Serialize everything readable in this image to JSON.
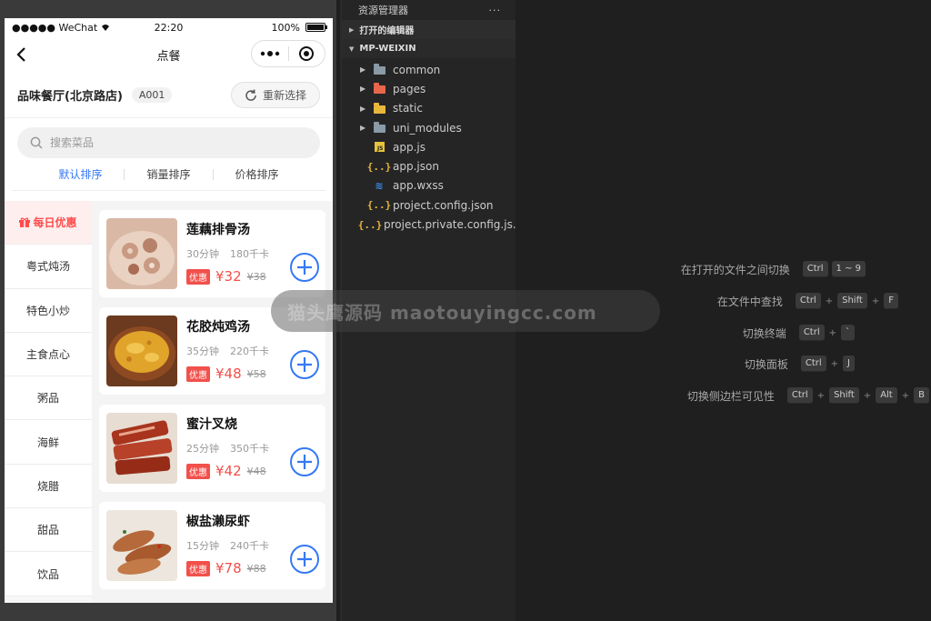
{
  "phone": {
    "status": {
      "carrier": "●●●●● WeChat",
      "time": "22:20",
      "battery": "100%"
    },
    "nav": {
      "title": "点餐"
    },
    "shop": {
      "name": "品味餐厅(北京路店)",
      "table": "A001",
      "reselect": "重新选择"
    },
    "search": {
      "placeholder": "搜索菜品"
    },
    "sort": [
      "默认排序",
      "销量排序",
      "价格排序"
    ],
    "categories": [
      "每日优惠",
      "粤式炖汤",
      "特色小炒",
      "主食点心",
      "粥品",
      "海鲜",
      "烧腊",
      "甜品",
      "饮品"
    ],
    "dishes": [
      {
        "name": "莲藕排骨汤",
        "time": "30分钟",
        "calories": "180千卡",
        "promo": "优惠",
        "price": "¥32",
        "old_price": "¥38"
      },
      {
        "name": "花胶炖鸡汤",
        "time": "35分钟",
        "calories": "220千卡",
        "promo": "优惠",
        "price": "¥48",
        "old_price": "¥58"
      },
      {
        "name": "蜜汁叉烧",
        "time": "25分钟",
        "calories": "350千卡",
        "promo": "优惠",
        "price": "¥42",
        "old_price": "¥48"
      },
      {
        "name": "椒盐濑尿虾",
        "time": "15分钟",
        "calories": "240千卡",
        "promo": "优惠",
        "price": "¥78",
        "old_price": "¥88"
      }
    ]
  },
  "watermark": "猫头鹰源码 maotouyingcc.com",
  "explorer": {
    "title": "资源管理器",
    "more": "···",
    "open_editors": "打开的编辑器",
    "project": "MP-WEIXIN",
    "items": [
      {
        "name": "common",
        "type": "folder",
        "color": "#8a9aa6"
      },
      {
        "name": "pages",
        "type": "folder",
        "color": "#e8674b"
      },
      {
        "name": "static",
        "type": "folder",
        "color": "#e8b83b"
      },
      {
        "name": "uni_modules",
        "type": "folder",
        "color": "#8a9aa6"
      },
      {
        "name": "app.js",
        "type": "js"
      },
      {
        "name": "app.json",
        "type": "json"
      },
      {
        "name": "app.wxss",
        "type": "css"
      },
      {
        "name": "project.config.json",
        "type": "json"
      },
      {
        "name": "project.private.config.js...",
        "type": "json"
      }
    ]
  },
  "shortcuts": [
    {
      "label": "在打开的文件之间切换",
      "keys": [
        "Ctrl",
        "1 ~ 9"
      ]
    },
    {
      "label": "在文件中查找",
      "keys": [
        "Ctrl",
        "Shift",
        "F"
      ]
    },
    {
      "label": "切换终端",
      "keys": [
        "Ctrl",
        "`"
      ]
    },
    {
      "label": "切换面板",
      "keys": [
        "Ctrl",
        "J"
      ]
    },
    {
      "label": "切换侧边栏可见性",
      "keys": [
        "Ctrl",
        "Shift",
        "Alt",
        "B"
      ]
    }
  ],
  "colors": {
    "accent": "#3478f6",
    "price": "#f2504b",
    "active_category": "#ff4d4d"
  }
}
